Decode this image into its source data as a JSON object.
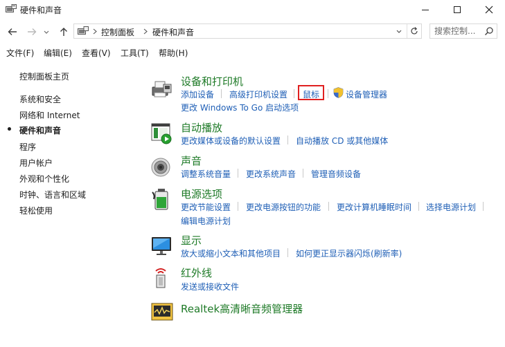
{
  "window": {
    "title": "硬件和声音",
    "minimize_icon": "minimize-icon",
    "maximize_icon": "maximize-icon",
    "close_icon": "close-icon"
  },
  "nav": {
    "breadcrumb": [
      "控制面板",
      "硬件和声音"
    ],
    "search_placeholder": "搜索控制..."
  },
  "menu": [
    "文件(F)",
    "编辑(E)",
    "查看(V)",
    "工具(T)",
    "帮助(H)"
  ],
  "sidebar": {
    "home": "控制面板主页",
    "items": [
      "系统和安全",
      "网络和 Internet",
      "硬件和声音",
      "程序",
      "用户帐户",
      "外观和个性化",
      "时钟、语言和区域",
      "轻松使用"
    ],
    "active": "硬件和声音"
  },
  "categories": [
    {
      "title": "设备和打印机",
      "icon": "devices-printers-icon",
      "links": [
        "添加设备",
        "高级打印机设置",
        "鼠标",
        "设备管理器",
        "更改 Windows To Go 启动选项"
      ]
    },
    {
      "title": "自动播放",
      "icon": "autoplay-icon",
      "links": [
        "更改媒体或设备的默认设置",
        "自动播放 CD 或其他媒体"
      ]
    },
    {
      "title": "声音",
      "icon": "speaker-icon",
      "links": [
        "调整系统音量",
        "更改系统声音",
        "管理音频设备"
      ]
    },
    {
      "title": "电源选项",
      "icon": "battery-icon",
      "links": [
        "更改节能设置",
        "更改电源按钮的功能",
        "更改计算机睡眠时间",
        "选择电源计划",
        "编辑电源计划"
      ]
    },
    {
      "title": "显示",
      "icon": "monitor-icon",
      "links": [
        "放大或缩小文本和其他项目",
        "如何更正显示器闪烁(刷新率)"
      ]
    },
    {
      "title": "红外线",
      "icon": "infrared-icon",
      "links": [
        "发送或接收文件"
      ]
    },
    {
      "title": "Realtek高清晰音频管理器",
      "icon": "realtek-audio-icon",
      "links": []
    }
  ],
  "colors": {
    "category_title": "#1e7a27",
    "link": "#1f5fb6",
    "highlight_box": "#e02020"
  }
}
